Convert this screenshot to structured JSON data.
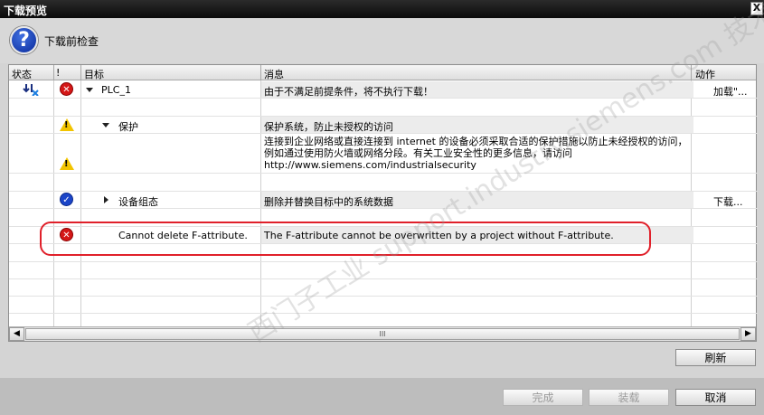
{
  "window": {
    "title": "下载预览",
    "close_glyph": "X"
  },
  "header": {
    "heading": "下载前检查",
    "icon": "question-icon"
  },
  "columns": {
    "status": "状态",
    "bang": "!",
    "target": "目标",
    "message": "消息",
    "action": "动作"
  },
  "rows": [
    {
      "target": "PLC_1",
      "message": "由于不满足前提条件，将不执行下载！",
      "action": "加载\"...",
      "icon": "error-icon"
    },
    {
      "target": "保护",
      "message": "保护系统，防止未授权的访问",
      "icon": "warning-icon"
    },
    {
      "message": "连接到企业网络或直接连接到 internet 的设备必须采取合适的保护措施以防止未经授权的访问，例如通过使用防火墙或网络分段。有关工业安全性的更多信息，请访问 http://www.siemens.com/industrialsecurity",
      "icon": "warning-icon"
    },
    {
      "target": "设备组态",
      "message": "删除并替换目标中的系统数据",
      "action": "下载...",
      "icon": "ok-icon"
    },
    {
      "target": "Cannot delete F-attribute.",
      "message": "The F-attribute cannot be overwritten by a project without F-attribute.",
      "icon": "error-icon"
    }
  ],
  "scrollbar": {
    "thumb_grip": "III"
  },
  "buttons": {
    "refresh": "刷新",
    "finish": "完成",
    "load": "装载",
    "cancel": "取消"
  },
  "watermark": "西门子工业  support.industry.siemens.com 技术论坛",
  "colors": {
    "error": "#d41717",
    "warning": "#f2c400",
    "ok": "#1b45c8",
    "annotation": "#e0202a"
  }
}
